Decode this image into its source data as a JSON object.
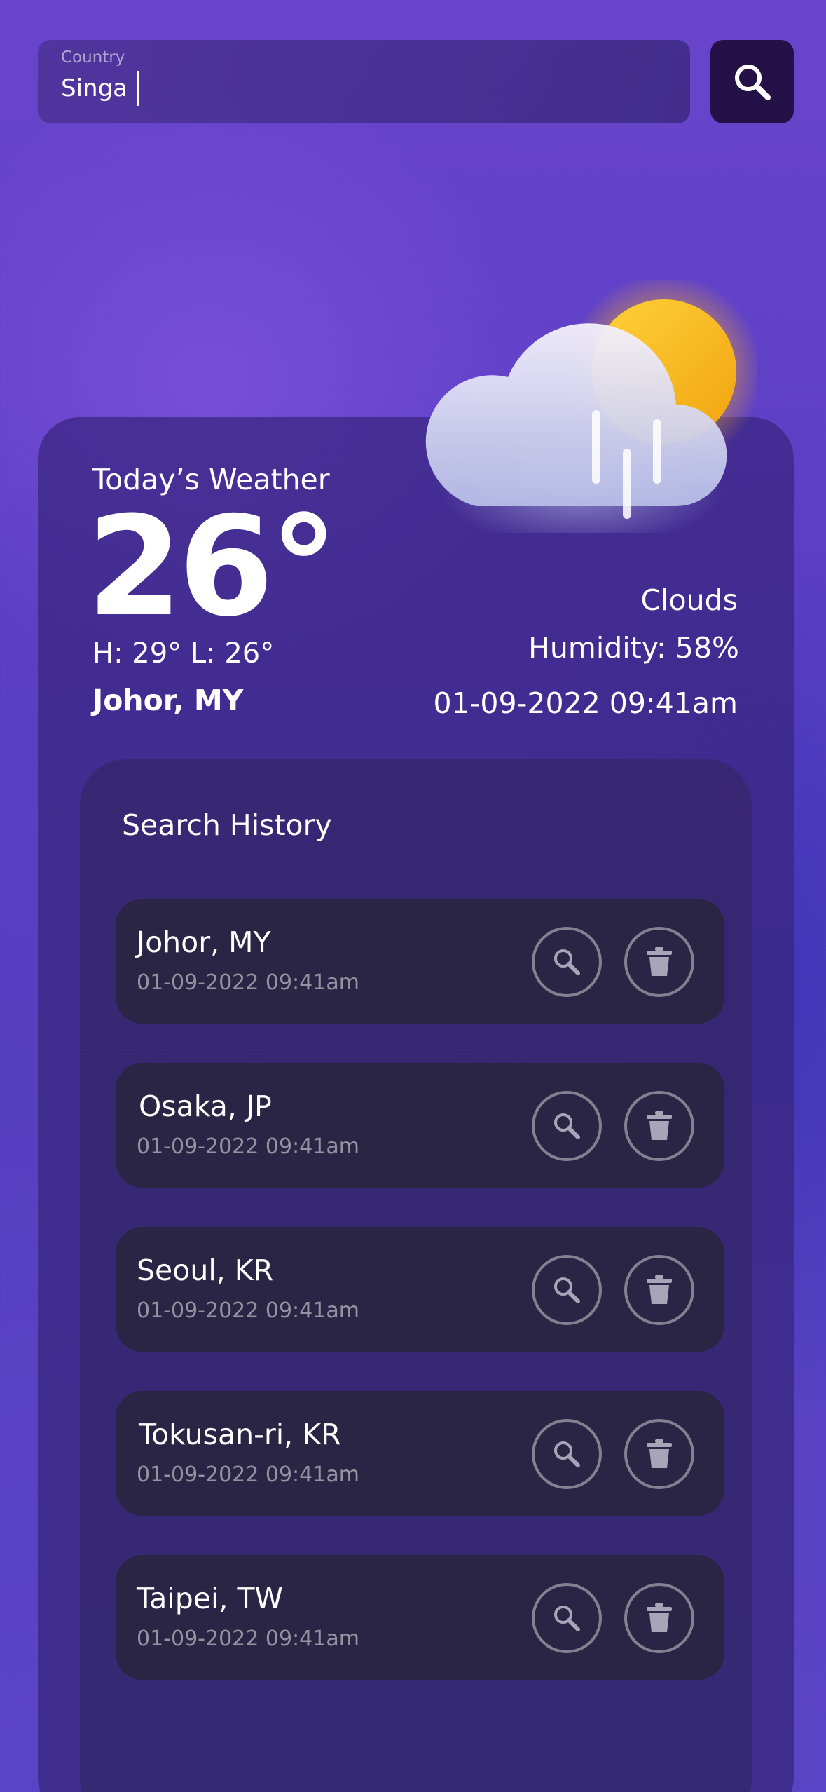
{
  "search": {
    "label": "Country",
    "value": "Singa"
  },
  "weather": {
    "title": "Today’s Weather",
    "temperature": "26°",
    "high_low": "H: 29° L: 26°",
    "location": "Johor, MY",
    "condition": "Clouds",
    "humidity": "Humidity: 58%",
    "datetime": "01-09-2022 09:41am",
    "icon": "sun-cloud-rain-icon"
  },
  "history": {
    "title": "Search History",
    "items": [
      {
        "city": "Johor, MY",
        "time": "01-09-2022 09:41am"
      },
      {
        "city": "Osaka, JP",
        "time": "01-09-2022 09:41am"
      },
      {
        "city": "Seoul, KR",
        "time": "01-09-2022 09:41am"
      },
      {
        "city": "Tokusan-ri, KR",
        "time": "01-09-2022 09:41am"
      },
      {
        "city": "Taipei, TW",
        "time": "01-09-2022 09:41am"
      }
    ]
  },
  "icons": {
    "search": "search-icon",
    "delete": "trash-icon"
  },
  "colors": {
    "background": "#5b3fc4",
    "search_button": "#241148",
    "row_background": "#2a2544",
    "sun": "#f5b81a"
  }
}
